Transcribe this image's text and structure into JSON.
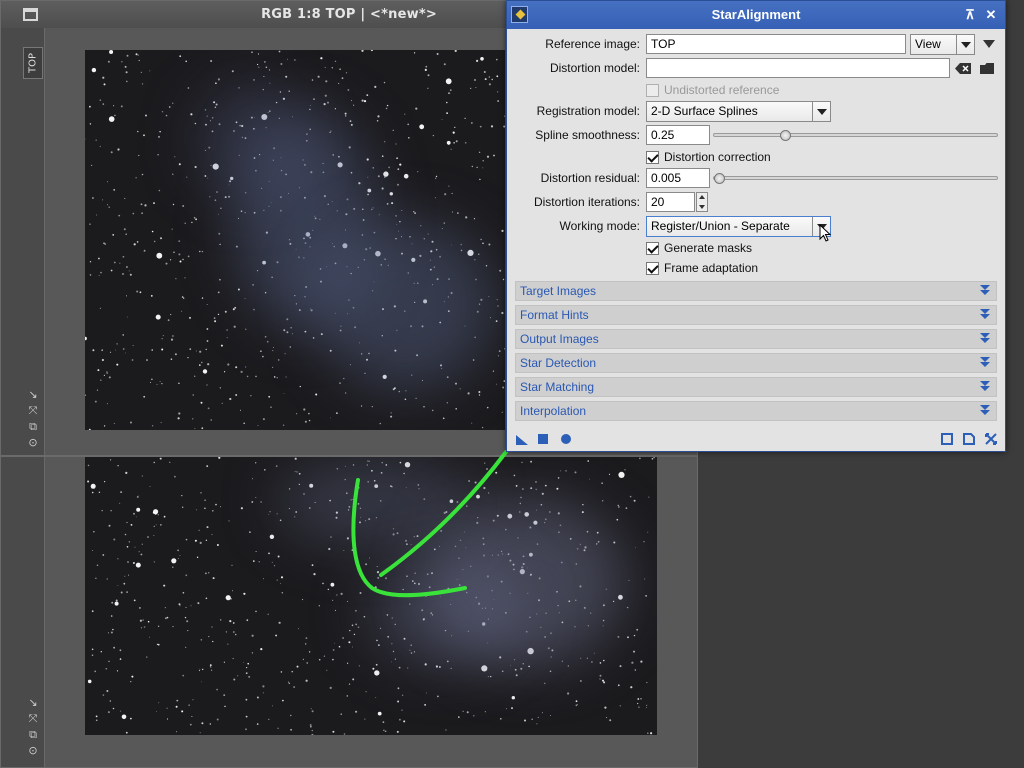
{
  "windows": {
    "top_view": {
      "title": "RGB 1:8 TOP | <*new*>",
      "tab_label": "TOP"
    }
  },
  "dialog": {
    "title": "StarAlignment",
    "reference_image": {
      "label": "Reference image:",
      "value": "TOP",
      "view_option": "View"
    },
    "distortion_model": {
      "label": "Distortion model:",
      "value": ""
    },
    "undistorted_reference": {
      "label": "Undistorted reference",
      "checked": false,
      "enabled": false
    },
    "registration_model": {
      "label": "Registration model:",
      "value": "2-D Surface Splines"
    },
    "spline_smoothness": {
      "label": "Spline smoothness:",
      "value": "0.25"
    },
    "distortion_correction": {
      "label": "Distortion correction",
      "checked": true
    },
    "distortion_residual": {
      "label": "Distortion residual:",
      "value": "0.005"
    },
    "distortion_iterations": {
      "label": "Distortion iterations:",
      "value": "20"
    },
    "working_mode": {
      "label": "Working mode:",
      "value": "Register/Union - Separate"
    },
    "generate_masks": {
      "label": "Generate masks",
      "checked": true
    },
    "frame_adaptation": {
      "label": "Frame adaptation",
      "checked": true
    },
    "sections": [
      "Target Images",
      "Format Hints",
      "Output Images",
      "Star Detection",
      "Star Matching",
      "Interpolation"
    ],
    "colors": {
      "title_bar": "#3a64b8",
      "section_text": "#2a58b3",
      "annotation": "#39e33a"
    }
  }
}
